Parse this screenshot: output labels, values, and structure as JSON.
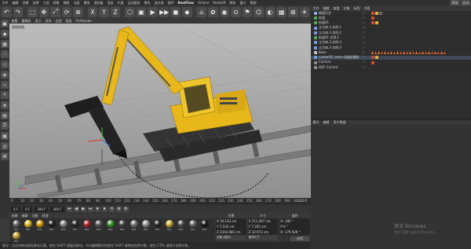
{
  "menubar": {
    "items": [
      "文件",
      "编辑",
      "创建",
      "选择",
      "工具",
      "网格",
      "捕捉",
      "动画",
      "模拟",
      "追踪器",
      "渲染",
      "扩展",
      "运动图形",
      "角色",
      "流水线",
      "插件",
      "RealFlow",
      "Octane",
      "Redshift",
      "脚本",
      "窗口",
      "帮助"
    ],
    "right": [
      "界面",
      "启动"
    ]
  },
  "toolbar": {
    "buttons": [
      "↶",
      "↷",
      "⬚",
      "✥",
      "⤢",
      "⟳",
      "⊕",
      "X",
      "Y",
      "Z",
      "⬡",
      "▣",
      "▶",
      "▶▶",
      "◼",
      "◆",
      "⌂",
      "✿",
      "◉",
      "⊙",
      "⚑",
      "⌬",
      "◐",
      "▦",
      "⊞",
      "☀"
    ]
  },
  "viewport": {
    "menu": [
      "查看",
      "摄像机",
      "显示",
      "选项",
      "过滤",
      "面板",
      "ProRender"
    ],
    "label": "透视视图"
  },
  "timeline": {
    "ticks": [
      "0",
      "10",
      "20",
      "30",
      "40",
      "50",
      "60",
      "70",
      "80",
      "90",
      "100",
      "110",
      "120",
      "130",
      "140",
      "150",
      "160",
      "170",
      "180",
      "190",
      "200",
      "210",
      "220",
      "230",
      "240",
      "250",
      "260",
      "270",
      "280",
      "290",
      "300"
    ],
    "end_label": "120 F"
  },
  "transport": {
    "start_field": "0 F",
    "current_field": "0 F",
    "end_field": "300 F",
    "end_field2": "300 F",
    "buttons": [
      "⏮",
      "◀",
      "▶",
      "⏭",
      "⏺",
      "⏹",
      "⟲",
      "⊕",
      "⚙"
    ]
  },
  "materials": {
    "menu": [
      "创建",
      "编辑",
      "功能",
      "纹理"
    ],
    "items": [
      {
        "name": "Mat",
        "color": "#6b6b6b"
      },
      {
        "name": "Mat",
        "color": "#e4c02a"
      },
      {
        "name": "Mat",
        "color": "#d9a20d"
      },
      {
        "name": "Mat",
        "color": "#1f1f1f"
      },
      {
        "name": "Mat",
        "color": "#8c8c8c"
      },
      {
        "name": "Mat",
        "color": "#2d2d2d"
      },
      {
        "name": "Mat",
        "color": "#b02a2a"
      },
      {
        "name": "Mat",
        "color": "#5d5d5d"
      },
      {
        "name": "Mat",
        "color": "#3e9e2e"
      },
      {
        "name": "Mat",
        "color": "#4a4a4a"
      },
      {
        "name": "Mat",
        "color": "#7d7d7d"
      },
      {
        "name": "Mat",
        "color": "#9b9b9b"
      },
      {
        "name": "Mat",
        "color": "#2a2a2a"
      },
      {
        "name": "Mat",
        "color": "#d0b040"
      },
      {
        "name": "Mat",
        "color": "#555"
      },
      {
        "name": "Mat",
        "color": "#6e6e6e"
      },
      {
        "name": "Mat",
        "color": "#1a1a1a"
      },
      {
        "name": "Mat",
        "color": "#c8a63a"
      }
    ]
  },
  "coords": {
    "headers": [
      "位置",
      "尺寸",
      "旋转"
    ],
    "rows": [
      [
        "X  16.132 cm",
        "X  211.467 cm",
        "H  -180 °"
      ],
      [
        "Y  7.102 cm",
        "Y  7.205 cm",
        "P  0 °"
      ],
      [
        "Z  2434.981 cm",
        "Z  32.973 cm",
        "B  -179.929 °"
      ]
    ],
    "mode": "对象 (相对)",
    "size_mode": "绝对尺寸",
    "apply": "应用"
  },
  "status": "移动 : 点击并拖动鼠标移动元素。按住 SHIFT 键量化移动；节点编辑模式时按住 SHIFT 键增加选择对象；按住 CTRL 键减少选择对象。",
  "object_manager": {
    "menu": [
      "文件",
      "编辑",
      "查看",
      "对象",
      "标签",
      "书签"
    ],
    "rows": [
      {
        "name": "物理天空",
        "color": "#8fb0d8",
        "tags": 3,
        "selected": false
      },
      {
        "name": "轨道",
        "color": "#58a858",
        "tags": 1,
        "selected": false
      },
      {
        "name": "轨道01",
        "color": "#58a858",
        "tags": 2,
        "selected": false
      },
      {
        "name": "立方体.3 实例.1",
        "color": "#7aa0e0",
        "tags": 0,
        "selected": false
      },
      {
        "name": "立方体.3 实例.2",
        "color": "#7aa0e0",
        "tags": 0,
        "selected": false
      },
      {
        "name": "轨道01 实例.1",
        "color": "#58a858",
        "tags": 0,
        "selected": false
      },
      {
        "name": "立方体.3 实例.3",
        "color": "#7aa0e0",
        "tags": 0,
        "selected": false
      },
      {
        "name": "立方体.3 实例.4",
        "color": "#7aa0e0",
        "tags": 0,
        "selected": false
      },
      {
        "name": "Base",
        "color": "#c8c8c8",
        "tags": 24,
        "selected": false
      },
      {
        "name": "camerOC cam+动画挖掘机",
        "color": "#7aa0e0",
        "tags": 2,
        "selected": true
      },
      {
        "name": "Camera",
        "color": "#8c8c8c",
        "tags": 1,
        "selected": false
      },
      {
        "name": "DOF Control",
        "color": "#8c8c8c",
        "tags": 0,
        "selected": false
      }
    ]
  },
  "attribute_manager": {
    "menu": [
      "模式",
      "编辑",
      "用户数据"
    ]
  },
  "watermark": {
    "title": "激活 Windows",
    "sub": "转到\"设置\"以激活 Windows。"
  }
}
